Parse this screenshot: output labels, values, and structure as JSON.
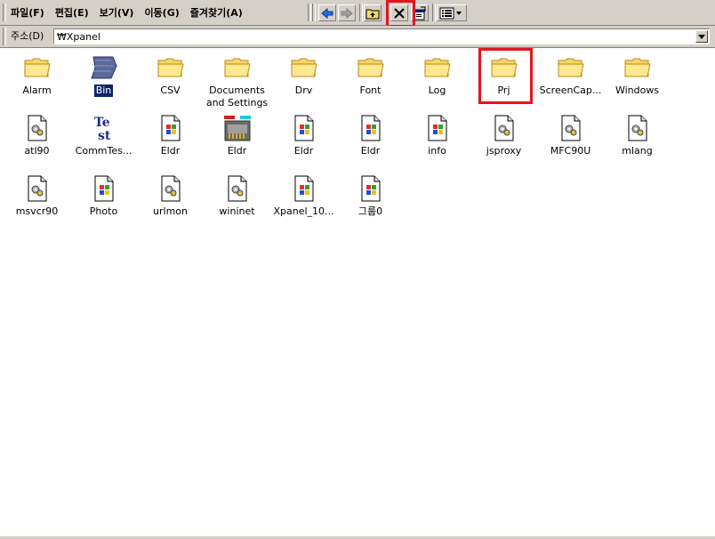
{
  "menu": {
    "file": "파일(F)",
    "edit": "편집(E)",
    "view": "보기(V)",
    "go": "이동(G)",
    "favorites": "즐겨찾기(A)"
  },
  "toolbar": {
    "back_icon": "back-arrow-icon",
    "forward_icon": "forward-arrow-icon",
    "up_icon": "up-folder-icon",
    "delete_icon": "delete-x-icon",
    "properties_icon": "properties-icon",
    "views_icon": "views-dropdown-icon",
    "highlight_color": "#e5141e"
  },
  "address": {
    "label": "주소(D)",
    "value": "₩Xpanel"
  },
  "files": [
    {
      "name": "Alarm",
      "icon": "folder-icon"
    },
    {
      "name": "Bin",
      "icon": "bin-icon",
      "selected": true
    },
    {
      "name": "CSV",
      "icon": "folder-icon"
    },
    {
      "name": "Documents\nand Settings",
      "icon": "folder-icon"
    },
    {
      "name": "Drv",
      "icon": "folder-icon"
    },
    {
      "name": "Font",
      "icon": "folder-icon"
    },
    {
      "name": "Log",
      "icon": "folder-icon"
    },
    {
      "name": "Prj",
      "icon": "folder-icon",
      "highlighted": true
    },
    {
      "name": "ScreenCap...",
      "icon": "folder-icon"
    },
    {
      "name": "Windows",
      "icon": "folder-icon"
    },
    {
      "name": "atl90",
      "icon": "dll-icon"
    },
    {
      "name": "CommTes...",
      "icon": "test-icon"
    },
    {
      "name": "Eldr",
      "icon": "exe-icon"
    },
    {
      "name": "Eldr",
      "icon": "network-icon"
    },
    {
      "name": "Eldr",
      "icon": "exe-icon"
    },
    {
      "name": "Eldr",
      "icon": "exe-icon"
    },
    {
      "name": "info",
      "icon": "exe-icon"
    },
    {
      "name": "jsproxy",
      "icon": "dll-icon"
    },
    {
      "name": "MFC90U",
      "icon": "dll-icon"
    },
    {
      "name": "mlang",
      "icon": "dll-icon"
    },
    {
      "name": "msvcr90",
      "icon": "dll-icon"
    },
    {
      "name": "Photo",
      "icon": "exe-icon"
    },
    {
      "name": "urlmon",
      "icon": "dll-icon"
    },
    {
      "name": "wininet",
      "icon": "dll-icon"
    },
    {
      "name": "Xpanel_10...",
      "icon": "exe-icon"
    },
    {
      "name": "그룹0",
      "icon": "exe-icon"
    }
  ]
}
